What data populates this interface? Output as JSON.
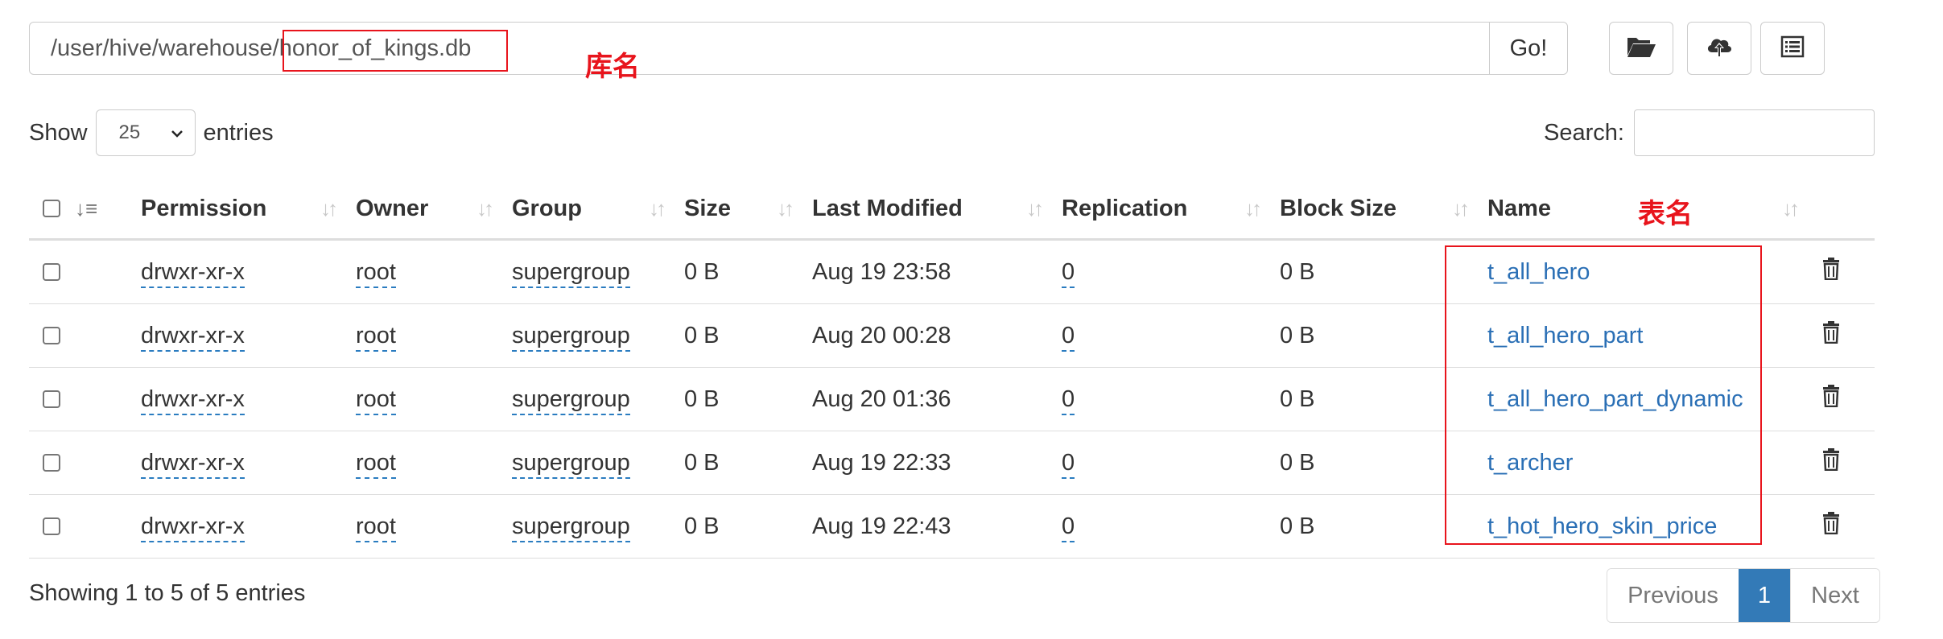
{
  "path_bar": {
    "value": "/user/hive/warehouse/honor_of_kings.db",
    "go_label": "Go!"
  },
  "annotations": {
    "db_label": "库名",
    "table_label": "表名"
  },
  "toolbar": {
    "icons": [
      "folder-open-icon",
      "upload-icon",
      "list-icon"
    ]
  },
  "length_menu": {
    "prefix": "Show",
    "value": "25",
    "suffix": "entries"
  },
  "search": {
    "label": "Search:",
    "value": ""
  },
  "table": {
    "columns": [
      "Permission",
      "Owner",
      "Group",
      "Size",
      "Last Modified",
      "Replication",
      "Block Size",
      "Name"
    ],
    "rows": [
      {
        "permission": "drwxr-xr-x",
        "owner": "root",
        "group": "supergroup",
        "size": "0 B",
        "modified": "Aug 19 23:58",
        "replication": "0",
        "block_size": "0 B",
        "name": "t_all_hero"
      },
      {
        "permission": "drwxr-xr-x",
        "owner": "root",
        "group": "supergroup",
        "size": "0 B",
        "modified": "Aug 20 00:28",
        "replication": "0",
        "block_size": "0 B",
        "name": "t_all_hero_part"
      },
      {
        "permission": "drwxr-xr-x",
        "owner": "root",
        "group": "supergroup",
        "size": "0 B",
        "modified": "Aug 20 01:36",
        "replication": "0",
        "block_size": "0 B",
        "name": "t_all_hero_part_dynamic"
      },
      {
        "permission": "drwxr-xr-x",
        "owner": "root",
        "group": "supergroup",
        "size": "0 B",
        "modified": "Aug 19 22:33",
        "replication": "0",
        "block_size": "0 B",
        "name": "t_archer"
      },
      {
        "permission": "drwxr-xr-x",
        "owner": "root",
        "group": "supergroup",
        "size": "0 B",
        "modified": "Aug 19 22:43",
        "replication": "0",
        "block_size": "0 B",
        "name": "t_hot_hero_skin_price"
      }
    ]
  },
  "footer": {
    "info": "Showing 1 to 5 of 5 entries",
    "previous": "Previous",
    "current_page": "1",
    "next": "Next"
  },
  "colors": {
    "annotation_red": "#e8141c",
    "link_blue": "#2a6fb5",
    "active_page": "#337ab7"
  }
}
